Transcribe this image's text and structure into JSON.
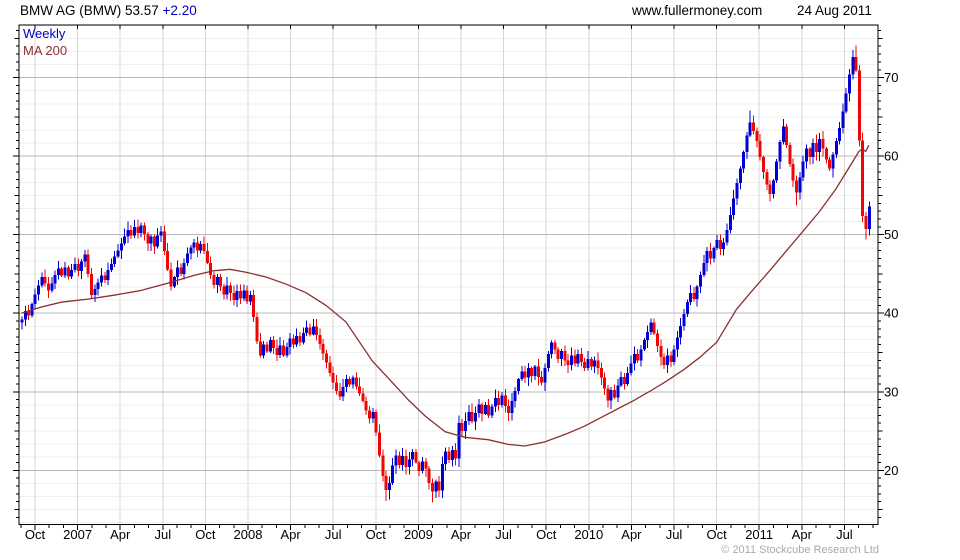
{
  "header": {
    "title": "BMW AG (BMW) 53.57",
    "change": "+2.20",
    "website": "www.fullermoney.com",
    "date": "24 Aug 2011"
  },
  "legend": {
    "timeframe": "Weekly",
    "ma": "MA 200"
  },
  "footer": {
    "copyright": "© 2011 Stockcube Research Ltd"
  },
  "colors": {
    "up": "#0000d0",
    "down": "#ee0606",
    "ma_line": "#8b3030",
    "change_text": "#0000bb",
    "timeframe_text": "#0000bb",
    "grid_major": "#b9b9b9",
    "grid_minor": "#efefef",
    "grid_vertical": "#d7d7d7",
    "axis": "#000000",
    "label_text": "#000000",
    "copyright_text": "#a9a9a9"
  },
  "chart_data": {
    "type": "candlestick",
    "instrument": "BMW AG (BMW)",
    "timeframe": "weekly",
    "last_price": 53.57,
    "change": 2.2,
    "title": "BMW AG (BMW) weekly candles with MA 200",
    "x_labels": [
      "Oct",
      "2007",
      "Apr",
      "Jul",
      "Oct",
      "2008",
      "Apr",
      "Jul",
      "Oct",
      "2009",
      "Apr",
      "Jul",
      "Oct",
      "2010",
      "Apr",
      "Jul",
      "Oct",
      "2011",
      "Apr",
      "Jul"
    ],
    "y_ticks": [
      20,
      30,
      40,
      50,
      60,
      70
    ],
    "y_range_top": 76.7,
    "y_range_bottom": 13.1,
    "first_open": 38.8,
    "closes": [
      39.2,
      40.3,
      39.7,
      41.2,
      42.4,
      43.5,
      44.6,
      43.8,
      42.9,
      43.8,
      44.9,
      45.7,
      44.8,
      45.8,
      44.7,
      45.5,
      46.3,
      45.4,
      46.6,
      47.5,
      45.0,
      42.3,
      43.1,
      43.9,
      44.8,
      44.2,
      45.5,
      46.3,
      47.2,
      48.0,
      48.9,
      49.8,
      50.6,
      49.9,
      51.0,
      50.2,
      51.2,
      50.1,
      48.9,
      49.8,
      48.5,
      49.9,
      50.4,
      47.9,
      45.6,
      43.4,
      44.6,
      45.8,
      45.0,
      46.4,
      47.6,
      48.4,
      49.0,
      48.0,
      48.8,
      47.9,
      46.4,
      44.9,
      43.6,
      44.6,
      43.4,
      42.4,
      43.5,
      42.6,
      41.7,
      42.8,
      41.9,
      42.9,
      41.5,
      42.3,
      39.5,
      36.4,
      34.6,
      36.0,
      35.1,
      36.6,
      35.6,
      34.7,
      35.9,
      34.6,
      35.7,
      36.8,
      36.0,
      37.1,
      36.3,
      37.5,
      38.2,
      37.3,
      38.3,
      37.2,
      36.1,
      34.9,
      33.7,
      32.4,
      31.2,
      30.1,
      29.4,
      30.6,
      31.6,
      30.9,
      31.8,
      30.7,
      29.8,
      28.8,
      27.6,
      26.6,
      27.4,
      24.8,
      21.9,
      19.3,
      17.5,
      18.4,
      20.6,
      21.9,
      20.7,
      21.8,
      20.4,
      21.4,
      22.3,
      21.0,
      19.9,
      21.1,
      20.2,
      18.4,
      17.3,
      18.6,
      17.4,
      20.8,
      22.4,
      21.3,
      22.6,
      21.5,
      26.0,
      25.0,
      26.3,
      27.4,
      26.2,
      27.3,
      28.4,
      27.2,
      28.3,
      27.0,
      28.1,
      29.2,
      28.3,
      29.5,
      28.2,
      27.3,
      28.8,
      30.1,
      31.6,
      32.6,
      31.8,
      33.0,
      32.0,
      33.2,
      31.9,
      31.2,
      33.0,
      34.8,
      36.3,
      35.4,
      34.2,
      35.2,
      34.0,
      33.4,
      34.6,
      33.6,
      34.8,
      33.8,
      33.0,
      34.2,
      33.2,
      34.0,
      33.0,
      31.8,
      30.4,
      28.9,
      30.2,
      29.3,
      30.8,
      31.9,
      31.0,
      32.4,
      33.6,
      34.8,
      34.0,
      35.4,
      36.6,
      37.6,
      38.8,
      37.4,
      35.8,
      34.4,
      33.4,
      34.6,
      33.8,
      35.4,
      36.9,
      38.4,
      39.9,
      41.4,
      42.6,
      41.8,
      43.4,
      44.9,
      46.4,
      47.9,
      47.0,
      48.3,
      49.3,
      48.2,
      49.0,
      50.6,
      52.5,
      54.6,
      56.6,
      58.4,
      60.5,
      62.6,
      64.3,
      63.2,
      61.9,
      59.9,
      58.0,
      56.4,
      55.2,
      56.9,
      59.3,
      61.8,
      63.8,
      61.4,
      59.0,
      56.9,
      55.4,
      57.3,
      59.3,
      61.0,
      59.9,
      61.7,
      60.5,
      62.2,
      61.0,
      59.6,
      58.4,
      60.2,
      61.9,
      63.6,
      65.7,
      68.0,
      70.4,
      72.6,
      70.9,
      62.0,
      52.4,
      50.7,
      53.57
    ],
    "wick_overrides": {
      "21": {
        "low": 41.8
      },
      "34": {
        "high": 51.9
      },
      "110": {
        "low": 16.1
      },
      "111": {
        "low": 16.3
      },
      "124": {
        "low": 15.9
      },
      "126": {
        "low": 16.6
      },
      "177": {
        "low": 28.0
      },
      "190": {
        "high": 39.3
      },
      "220": {
        "high": 65.8
      },
      "221": {
        "high": 65.2
      },
      "226": {
        "low": 54.2
      },
      "234": {
        "low": 53.7
      },
      "252": {
        "high": 74.1
      },
      "254": {
        "low": 51.6
      },
      "255": {
        "low": 49.4
      },
      "256": {
        "low": 49.9,
        "high": 54.2
      }
    },
    "ma200": [
      [
        0,
        40.0
      ],
      [
        6,
        40.8
      ],
      [
        12,
        41.4
      ],
      [
        20,
        41.8
      ],
      [
        28,
        42.3
      ],
      [
        36,
        42.9
      ],
      [
        44,
        43.8
      ],
      [
        52,
        44.8
      ],
      [
        58,
        45.4
      ],
      [
        63,
        45.6
      ],
      [
        68,
        45.2
      ],
      [
        74,
        44.6
      ],
      [
        80,
        43.7
      ],
      [
        86,
        42.6
      ],
      [
        92,
        41.0
      ],
      [
        98,
        38.9
      ],
      [
        106,
        33.9
      ],
      [
        112,
        31.2
      ],
      [
        117,
        28.9
      ],
      [
        122,
        26.9
      ],
      [
        128,
        24.9
      ],
      [
        134,
        24.2
      ],
      [
        141,
        23.9
      ],
      [
        147,
        23.3
      ],
      [
        152,
        23.1
      ],
      [
        158,
        23.6
      ],
      [
        165,
        24.7
      ],
      [
        170,
        25.6
      ],
      [
        175,
        26.7
      ],
      [
        180,
        27.8
      ],
      [
        185,
        28.9
      ],
      [
        190,
        30.1
      ],
      [
        195,
        31.4
      ],
      [
        200,
        32.8
      ],
      [
        205,
        34.4
      ],
      [
        210,
        36.3
      ],
      [
        216,
        40.5
      ],
      [
        221,
        43.0
      ],
      [
        226,
        45.4
      ],
      [
        231,
        47.9
      ],
      [
        236,
        50.4
      ],
      [
        241,
        52.9
      ],
      [
        246,
        55.8
      ],
      [
        251,
        59.2
      ],
      [
        253,
        60.6
      ],
      [
        254,
        60.9
      ],
      [
        255,
        60.6
      ],
      [
        256,
        61.4
      ]
    ]
  }
}
